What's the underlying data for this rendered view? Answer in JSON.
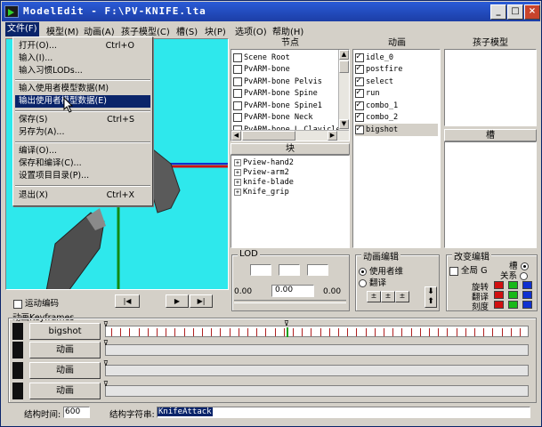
{
  "window": {
    "title": "ModelEdit - F:\\PV-KNIFE.lta"
  },
  "menubar": [
    "文件(F)",
    "模型(M)",
    "动画(A)",
    "孩子模型(C)",
    "槽(S)",
    "块(P)",
    "选项(O)",
    "帮助(H)"
  ],
  "file_menu": {
    "items": [
      {
        "label": "打开(O)...",
        "shortcut": "Ctrl+O"
      },
      {
        "label": "输入(I)...",
        "shortcut": ""
      },
      {
        "label": "输入习惯LODs...",
        "shortcut": ""
      },
      {
        "label": "输入使用者模型数据(M)",
        "shortcut": ""
      },
      {
        "label": "输出使用者模型数据(E)",
        "shortcut": ""
      },
      {
        "label": "保存(S)",
        "shortcut": "Ctrl+S"
      },
      {
        "label": "另存为(A)...",
        "shortcut": ""
      },
      {
        "label": "编译(O)...",
        "shortcut": ""
      },
      {
        "label": "保存和编译(C)...",
        "shortcut": ""
      },
      {
        "label": "设置项目目录(P)...",
        "shortcut": ""
      },
      {
        "label": "退出(X)",
        "shortcut": "Ctrl+X"
      }
    ]
  },
  "nodes": {
    "header": "节点",
    "items": [
      "Scene Root",
      "PvARM-bone",
      "PvARM-bone Pelvis",
      "PvARM-bone Spine",
      "PvARM-bone Spine1",
      "PvARM-bone Neck",
      "PvARM-bone L Clavicle"
    ]
  },
  "animations": {
    "header": "动画",
    "items": [
      "idle_0",
      "postfire",
      "select",
      "run",
      "combo_1",
      "combo_2",
      "bigshot"
    ]
  },
  "child_models": {
    "header": "孩子模型"
  },
  "sockets": {
    "header": "槽"
  },
  "pieces": {
    "header": "块",
    "items": [
      "Pview-hand2",
      "Pview-arm2",
      "knife-blade",
      "Knife_grip"
    ]
  },
  "lod": {
    "label": "LOD",
    "left_value": "0.00",
    "mid_value": "0.00",
    "right_value": "0.00"
  },
  "anim_edit": {
    "label": "动画编辑",
    "options": [
      "使用者维",
      "翻译"
    ]
  },
  "transform_edit": {
    "label": "改变编辑",
    "global": "全局",
    "global_g": "G",
    "socket": "槽",
    "relation": "关系",
    "rows": [
      "旋转",
      "翻译",
      "刻度"
    ]
  },
  "playback": {
    "motion_check": "运动编码",
    "keyframes_label": "动画Keyframes"
  },
  "tracks": [
    {
      "label": "bigshot"
    },
    {
      "label": "动画"
    },
    {
      "label": "动画"
    },
    {
      "label": "动画"
    }
  ],
  "footer": {
    "time_label": "结构时间:",
    "time_value": "600",
    "string_label": "结构字符串:",
    "string_value": "KnifeAttack"
  },
  "colors": {
    "viewport": "#2ee8ec",
    "menu_highlight": "#0a246a",
    "title_bar": "#1c3ea6",
    "red_swatch": "#d01010",
    "green_swatch": "#18b818",
    "blue_swatch": "#1030d0"
  }
}
